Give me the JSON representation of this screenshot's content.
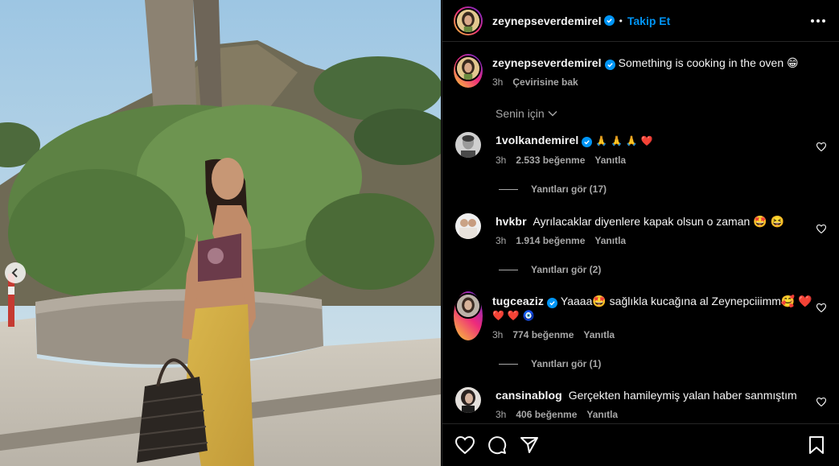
{
  "header": {
    "username": "zeynepseverdemirel",
    "separator": "•",
    "follow_label": "Takip Et"
  },
  "caption": {
    "username": "zeynepseverdemirel",
    "text": "Something is cooking in the oven 😁",
    "time": "3h",
    "translate": "Çevirisine bak"
  },
  "filter": {
    "label": "Senin için"
  },
  "comments": [
    {
      "username": "1volkandemirel",
      "text": "🙏 🙏 🙏 ❤️",
      "time": "3h",
      "likes": "2.533 beğenme",
      "reply": "Yanıtla",
      "view_replies": "Yanıtları gör (17)"
    },
    {
      "username": "hvkbr",
      "text": "Ayrılacaklar diyenlere kapak olsun o zaman 🤩 😆",
      "time": "3h",
      "likes": "1.914 beğenme",
      "reply": "Yanıtla",
      "view_replies": "Yanıtları gör (2)"
    },
    {
      "username": "tugceaziz",
      "text": "Yaaaa🤩 sağlıkla kucağına al Zeynepciiimm🥰 ❤️",
      "text2": "❤️ ❤️ 🧿",
      "time": "3h",
      "likes": "774 beğenme",
      "reply": "Yanıtla",
      "view_replies": "Yanıtları gör (1)"
    },
    {
      "username": "cansinablog",
      "text": "Gerçekten hamileymiş yalan haber sanmıştım",
      "time": "3h",
      "likes": "406 beğenme",
      "reply": "Yanıtla"
    }
  ],
  "colors": {
    "link": "#0095f6",
    "muted": "#a8a8a8",
    "background": "#000000"
  }
}
